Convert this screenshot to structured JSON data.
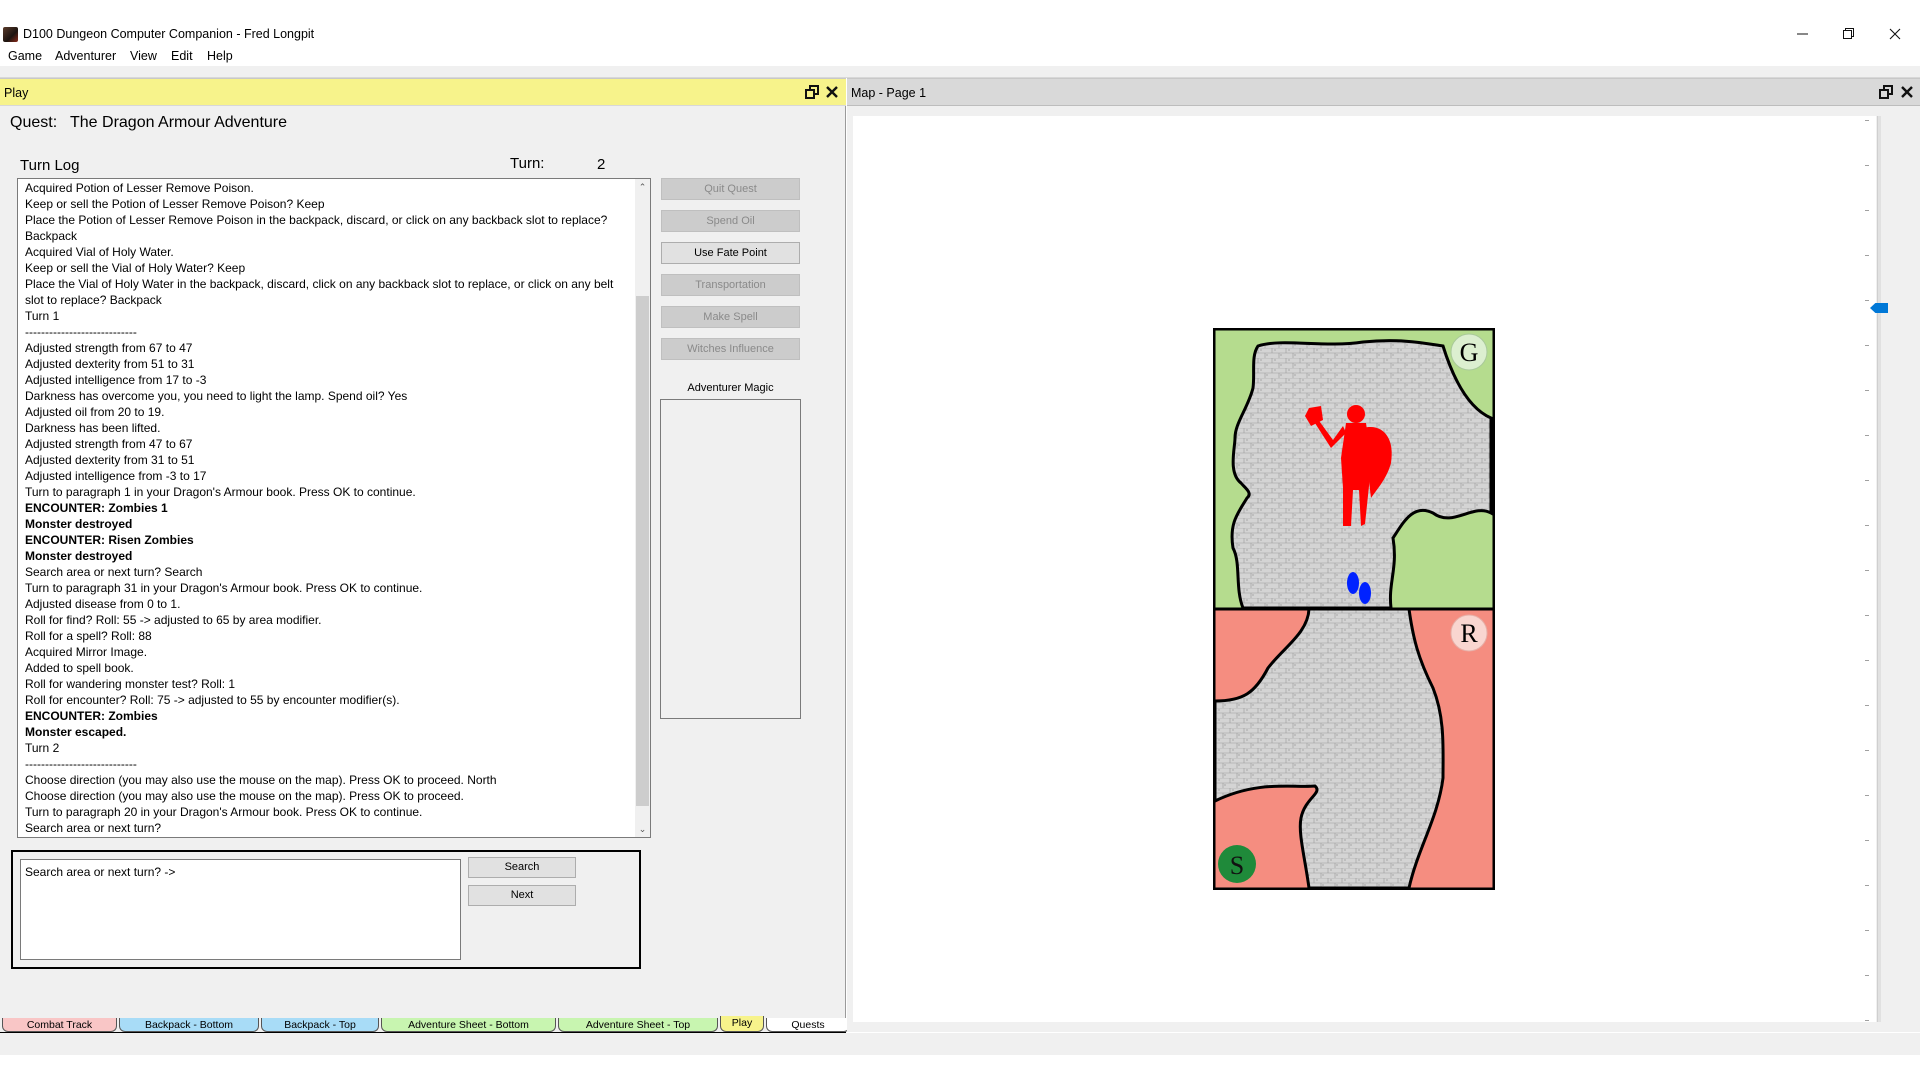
{
  "window": {
    "title": "D100 Dungeon Computer Companion - Fred Longpit",
    "minimize_icon": "minimize-icon",
    "restore_icon": "restore-icon",
    "close_icon": "close-icon"
  },
  "menu": [
    "Game",
    "Adventurer",
    "View",
    "Edit",
    "Help"
  ],
  "play_panel": {
    "title": "Play",
    "header_color": "#f7f38b",
    "quest_label": "Quest:",
    "quest_name": "The Dragon Armour Adventure",
    "turn_log_label": "Turn Log",
    "turn_label": "Turn:",
    "turn_value": "2",
    "turn_log": [
      {
        "text": "Acquired Potion of Lesser Remove Poison.",
        "bold": false
      },
      {
        "text": "Keep or sell the Potion of Lesser Remove Poison? Keep",
        "bold": false
      },
      {
        "text": "Place the Potion of Lesser Remove Poison in the backpack, discard, or click on any backback slot to replace? Backpack",
        "bold": false
      },
      {
        "text": "Acquired Vial of Holy Water.",
        "bold": false
      },
      {
        "text": "Keep or sell the Vial of Holy Water? Keep",
        "bold": false
      },
      {
        "text": "Place the Vial of Holy Water in the backpack, discard, click on any backback slot to replace, or click on any belt slot to replace? Backpack",
        "bold": false
      },
      {
        "text": "Turn 1",
        "bold": false
      },
      {
        "text": "----------------------------",
        "bold": false
      },
      {
        "text": "Adjusted strength from 67 to 47",
        "bold": false
      },
      {
        "text": "Adjusted dexterity from 51 to 31",
        "bold": false
      },
      {
        "text": "Adjusted intelligence from 17 to -3",
        "bold": false
      },
      {
        "text": "Darkness has overcome you, you need to light the lamp. Spend oil? Yes",
        "bold": false
      },
      {
        "text": "Adjusted oil from 20 to 19.",
        "bold": false
      },
      {
        "text": "Darkness has been lifted.",
        "bold": false
      },
      {
        "text": "Adjusted strength from 47 to 67",
        "bold": false
      },
      {
        "text": "Adjusted dexterity from 31 to 51",
        "bold": false
      },
      {
        "text": "Adjusted intelligence from -3 to 17",
        "bold": false
      },
      {
        "text": "Turn to paragraph 1 in your Dragon's Armour book. Press OK to continue.",
        "bold": false
      },
      {
        "text": "ENCOUNTER: Zombies 1",
        "bold": true
      },
      {
        "text": "Monster destroyed",
        "bold": true
      },
      {
        "text": "ENCOUNTER: Risen Zombies",
        "bold": true
      },
      {
        "text": "Monster destroyed",
        "bold": true
      },
      {
        "text": "Search area or next turn? Search",
        "bold": false
      },
      {
        "text": "Turn to paragraph 31 in your Dragon's Armour book. Press OK to continue.",
        "bold": false
      },
      {
        "text": "Adjusted disease from 0 to 1.",
        "bold": false
      },
      {
        "text": "Roll for find? Roll: 55 -> adjusted to 65 by area modifier.",
        "bold": false
      },
      {
        "text": "Roll for a spell? Roll: 88",
        "bold": false
      },
      {
        "text": "Acquired Mirror Image.",
        "bold": false
      },
      {
        "text": "Added to spell book.",
        "bold": false
      },
      {
        "text": "Roll for wandering monster test? Roll: 1",
        "bold": false
      },
      {
        "text": "Roll for encounter? Roll: 75 -> adjusted to 55 by encounter modifier(s).",
        "bold": false
      },
      {
        "text": "ENCOUNTER: Zombies",
        "bold": true
      },
      {
        "text": "Monster escaped.",
        "bold": true
      },
      {
        "text": "Turn 2",
        "bold": false
      },
      {
        "text": "----------------------------",
        "bold": false
      },
      {
        "text": "Choose direction (you may also use the mouse on the map). Press OK to proceed. North",
        "bold": false
      },
      {
        "text": "Choose direction (you may also use the mouse on the map). Press OK to proceed.",
        "bold": false
      },
      {
        "text": "Turn to paragraph 20 in your Dragon's Armour book. Press OK to continue.",
        "bold": false
      },
      {
        "text": "Search area or next turn?",
        "bold": false
      }
    ],
    "side_buttons": [
      {
        "label": "Quit Quest",
        "enabled": false
      },
      {
        "label": "Spend Oil",
        "enabled": false
      },
      {
        "label": "Use Fate Point",
        "enabled": true
      },
      {
        "label": "Transportation",
        "enabled": false
      },
      {
        "label": "Make Spell",
        "enabled": false
      },
      {
        "label": "Witches Influence",
        "enabled": false
      }
    ],
    "adventurer_magic_label": "Adventurer Magic",
    "prompt_text": "Search area or next turn? ->",
    "search_button": "Search",
    "next_button": "Next"
  },
  "tabs": [
    {
      "label": "Combat Track",
      "color": "#f9c6c6",
      "active": false
    },
    {
      "label": "Backpack - Bottom",
      "color": "#a8dcf7",
      "active": false
    },
    {
      "label": "Backpack - Top",
      "color": "#a8dcf7",
      "active": false
    },
    {
      "label": "Adventure Sheet - Bottom",
      "color": "#c8f5b0",
      "active": false
    },
    {
      "label": "Adventure Sheet - Top",
      "color": "#c8f5b0",
      "active": false
    },
    {
      "label": "Play",
      "color": "#f7f38b",
      "active": true
    },
    {
      "label": "Quests",
      "color": "#ffffff",
      "active": false
    }
  ],
  "map_panel": {
    "title": "Map - Page 1",
    "tiles": [
      {
        "type": "green",
        "label": "G",
        "color": "#b5dc8e",
        "badge_color": "#dcefd0",
        "contents": [
          "armoured-warrior-icon",
          "footprints-icon"
        ]
      },
      {
        "type": "red",
        "label": "R",
        "color": "#f58d80",
        "badge_color": "#f9d6d0",
        "contents": [
          "start-marker"
        ]
      }
    ],
    "start_marker": "S",
    "start_marker_color": "#1f8a3a",
    "monster_color": "#ff0000",
    "footprints_color": "#0022ff",
    "slider_accent": "#0078d7"
  }
}
